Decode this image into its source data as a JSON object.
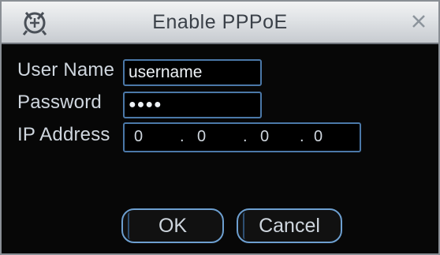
{
  "dialog": {
    "title": "Enable PPPoE",
    "icons": {
      "app": "dvr-logo-icon",
      "close": "close-icon"
    }
  },
  "form": {
    "username_label": "User Name",
    "username_value": "username",
    "password_label": "Password",
    "password_value": "●●●●",
    "ip_label": "IP Address",
    "ip_octets": [
      "0",
      "0",
      "0",
      "0"
    ],
    "ip_separator": "."
  },
  "buttons": {
    "ok_label": "OK",
    "cancel_label": "Cancel"
  },
  "colors": {
    "panel_bg": "#070707",
    "field_border": "#4b78a8",
    "button_border": "#6d9fd0",
    "title_text": "#3a4048",
    "label_text": "#cfd6de"
  }
}
